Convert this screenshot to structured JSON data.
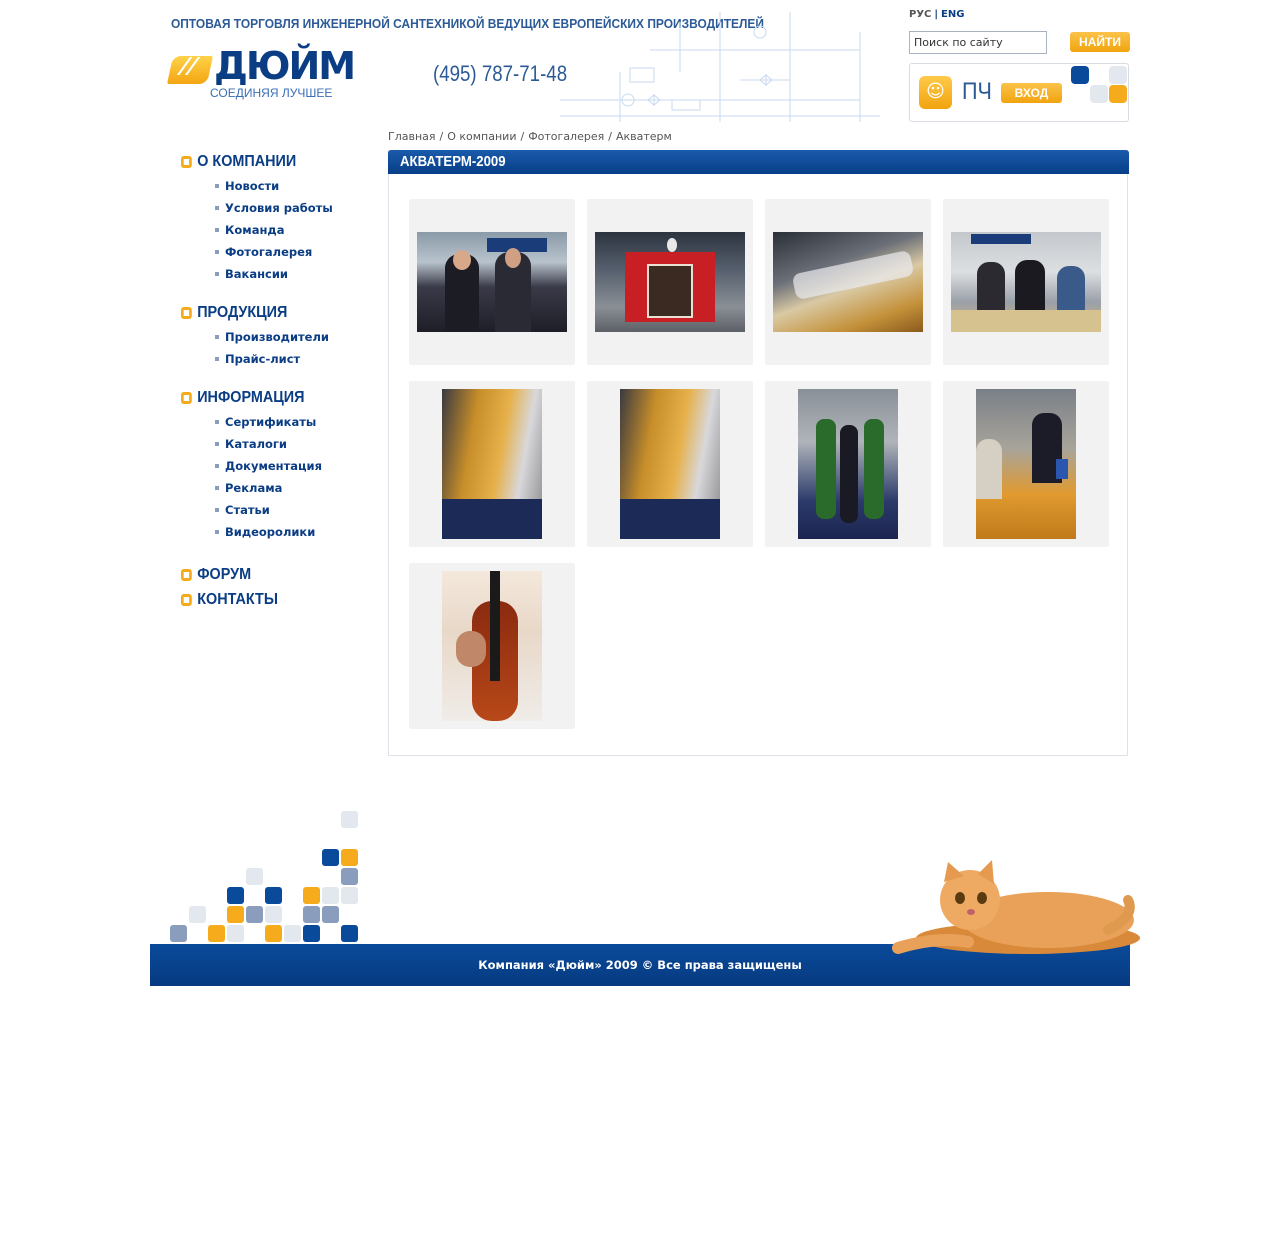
{
  "header": {
    "tagline": "ОПТОВАЯ ТОРГОВЛЯ ИНЖЕНЕРНОЙ САНТЕХНИКОЙ ВЕДУЩИХ ЕВРОПЕЙСКИХ ПРОИЗВОДИТЕЛЕЙ",
    "logo_text": "ДЮЙМ",
    "logo_mark": "//",
    "slogan": "СОЕДИНЯЯ ЛУЧШЕЕ",
    "phone": "(495) 787-71-48",
    "lang_ru": "РУС",
    "lang_sep": "|",
    "lang_en": "ENG",
    "search_placeholder": "Поиск по сайту",
    "search_button": "НАЙТИ",
    "pch_label": "ПЧ",
    "login_button": "ВХОД"
  },
  "breadcrumb": {
    "items": [
      "Главная",
      "О компании",
      "Фотогалерея",
      "Акватерм"
    ],
    "separator": "/"
  },
  "sidebar": {
    "sections": [
      {
        "title": "О КОМПАНИИ",
        "items": [
          "Новости",
          "Условия работы",
          "Команда",
          "Фотогалерея",
          "Вакансии"
        ]
      },
      {
        "title": "ПРОДУКЦИЯ",
        "items": [
          "Производители",
          "Прайс-лист"
        ]
      },
      {
        "title": "ИНФОРМАЦИЯ",
        "items": [
          "Сертификаты",
          "Каталоги",
          "Документация",
          "Реклама",
          "Статьи",
          "Видеоролики"
        ]
      },
      {
        "title": "ФОРУМ",
        "items": []
      },
      {
        "title": "КОНТАКТЫ",
        "items": []
      }
    ]
  },
  "gallery": {
    "title": "АКВАТЕРМ-2009",
    "photos": [
      {
        "name": "photo-two-men-at-stand",
        "orientation": "landscape"
      },
      {
        "name": "photo-red-exhibition-stand",
        "orientation": "landscape"
      },
      {
        "name": "photo-curved-logo-wall",
        "orientation": "landscape"
      },
      {
        "name": "photo-women-at-reception",
        "orientation": "landscape"
      },
      {
        "name": "photo-stand-perspective-1",
        "orientation": "portrait"
      },
      {
        "name": "photo-stand-perspective-2",
        "orientation": "portrait"
      },
      {
        "name": "photo-promo-girls",
        "orientation": "portrait"
      },
      {
        "name": "photo-negotiation-table",
        "orientation": "portrait"
      },
      {
        "name": "photo-violin",
        "orientation": "portrait"
      }
    ]
  },
  "footer": {
    "copyright": "Компания «Дюйм» 2009 © Все права защищены"
  },
  "colors": {
    "brand_blue": "#0a3d84",
    "accent_orange": "#f5ab1b",
    "footer_blue": "#073e88"
  }
}
